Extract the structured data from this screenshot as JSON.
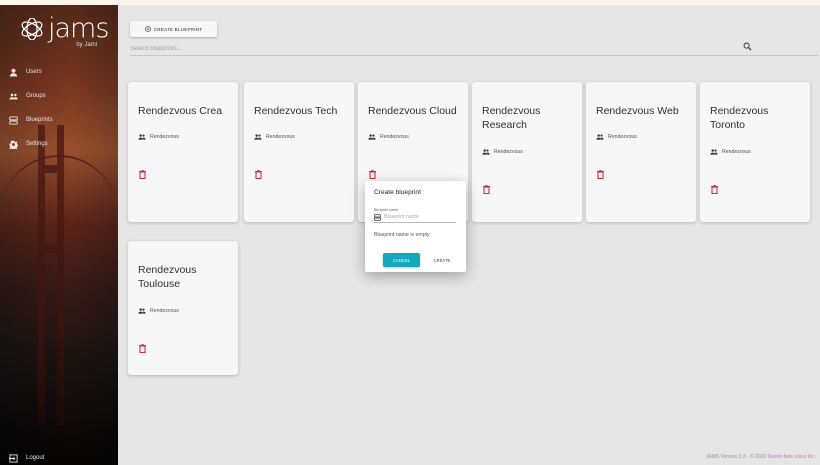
{
  "app": {
    "logo_text": "jams",
    "logo_sub": "by Jami"
  },
  "sidebar": {
    "items": [
      {
        "label": "Users",
        "icon": "person-icon"
      },
      {
        "label": "Groups",
        "icon": "groups-icon"
      },
      {
        "label": "Blueprints",
        "icon": "blueprint-icon"
      },
      {
        "label": "Settings",
        "icon": "gear-icon"
      }
    ],
    "logout_label": "Logout"
  },
  "toolbar": {
    "create_label": "CREATE BLUEPRINT",
    "search_placeholder": "Search blueprints..."
  },
  "blueprints": [
    {
      "name": "Rendezvous Crea",
      "group": "Rendezvous"
    },
    {
      "name": "Rendezvous Tech",
      "group": "Rendezvous"
    },
    {
      "name": "Rendezvous Cloud",
      "group": "Rendezvous"
    },
    {
      "name": "Rendezvous Research",
      "group": "Rendezvous"
    },
    {
      "name": "Rendezvous Web",
      "group": "Rendezvous"
    },
    {
      "name": "Rendezvous Toronto",
      "group": "Rendezvous"
    },
    {
      "name": "Rendezvous Toulouse",
      "group": "Rendezvous"
    }
  ],
  "dialog": {
    "title": "Create blueprint",
    "field_label": "Blueprint name",
    "field_placeholder": "Blueprint name",
    "field_value": "",
    "error": "Blueprint name is empty",
    "cancel_label": "CANCEL",
    "create_label": "CREATE"
  },
  "footer": {
    "text": "JAMS Version 3.3 - © 2022",
    "brand": "Savoir-faire Linux Inc."
  },
  "colors": {
    "accent": "#16a9be",
    "delete": "#d0343f",
    "brand_link": "#c07fa5"
  }
}
